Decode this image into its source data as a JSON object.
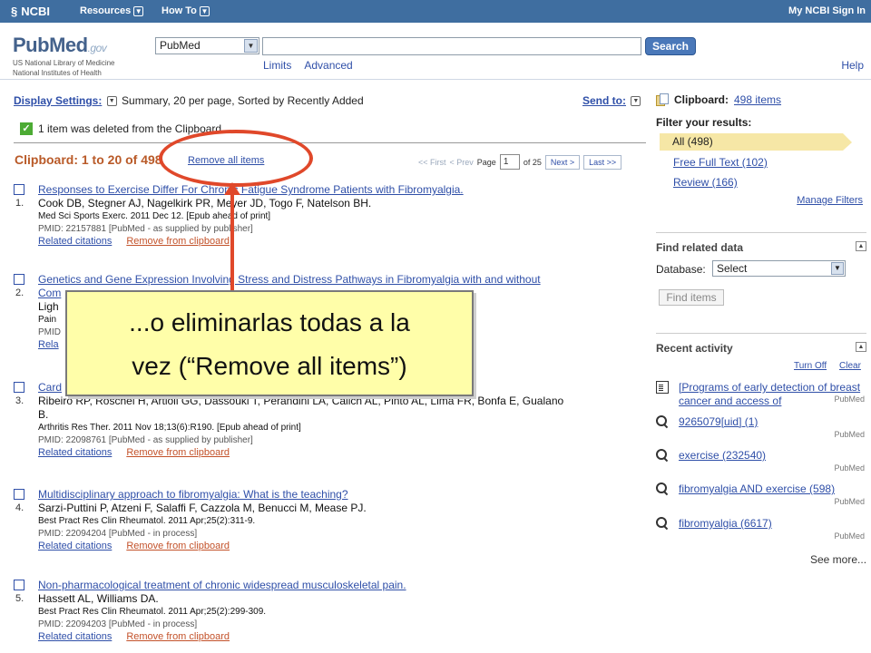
{
  "topbar": {
    "logo": "NCBI",
    "resources": "Resources",
    "howto": "How To",
    "right": "My NCBI  Sign In"
  },
  "header": {
    "brand_main": "Pub",
    "brand_m": "M",
    "brand_ed": "ed",
    "brand_gov": ".gov",
    "sub1": "US National Library of Medicine",
    "sub2": "National Institutes of Health",
    "db_selected": "PubMed",
    "search_value": "",
    "search_button": "Search",
    "limits": "Limits",
    "advanced": "Advanced",
    "help": "Help"
  },
  "display": {
    "label": "Display Settings:",
    "value": "Summary, 20 per page, Sorted by Recently Added",
    "send_to": "Send to:"
  },
  "notice": "1 item was deleted from the Clipboard",
  "clipboard": {
    "title": "Clipboard: 1 to 20 of 498",
    "remove_all": "Remove all items"
  },
  "pager": {
    "first": "<< First",
    "prev": "< Prev",
    "page_label": "Page",
    "page": "1",
    "of": "of 25",
    "next": "Next >",
    "last": "Last >>"
  },
  "results": [
    {
      "num": "1.",
      "title": "Responses to Exercise Differ For Chronic Fatigue Syndrome Patients with Fibromyalgia.",
      "authors": "Cook DB, Stegner AJ, Nagelkirk PR, Meyer JD, Togo F, Natelson BH.",
      "journal": "Med Sci Sports Exerc. 2011 Dec 12. [Epub ahead of print]",
      "pmid": "PMID: 22157881 [PubMed - as supplied by publisher]"
    },
    {
      "num": "2.",
      "title": "Genetics and Gene Expression Involving Stress and Distress Pathways in Fibromyalgia with and without",
      "title2": "Com",
      "authors": "Ligh",
      "journal": "Pain",
      "pmid": "PMID"
    },
    {
      "num": "3.",
      "title": "Card",
      "authors": "Ribeiro RP, Roschel H, Artioli GG, Dassouki T, Perandini LA, Calich AL, Pinto AL, Lima FR, Bonfa E, Gualano",
      "authors2": "B.",
      "journal": "Arthritis Res Ther. 2011 Nov 18;13(6):R190. [Epub ahead of print]",
      "pmid": "PMID: 22098761 [PubMed - as supplied by publisher]"
    },
    {
      "num": "4.",
      "title": "Multidisciplinary approach to fibromyalgia: What is the teaching?",
      "authors": "Sarzi-Puttini P, Atzeni F, Salaffi F, Cazzola M, Benucci M, Mease PJ.",
      "journal": "Best Pract Res Clin Rheumatol. 2011 Apr;25(2):311-9.",
      "pmid": "PMID: 22094204 [PubMed - in process]"
    },
    {
      "num": "5.",
      "title": "Non-pharmacological treatment of chronic widespread musculoskeletal pain.",
      "authors": "Hassett AL, Williams DA.",
      "journal": "Best Pract Res Clin Rheumatol. 2011 Apr;25(2):299-309.",
      "pmid": "PMID: 22094203 [PubMed - in process]"
    }
  ],
  "result_links": {
    "related": "Related citations",
    "remove": "Remove from clipboard",
    "rel_cut": "Rela"
  },
  "sidebar": {
    "clip_label": "Clipboard:",
    "clip_count": "498 items",
    "filter_header": "Filter your results:",
    "filter_all": "All (498)",
    "filter_free": "Free Full Text (102)",
    "filter_review": "Review (166)",
    "manage": "Manage Filters",
    "find_header": "Find related data",
    "db_label": "Database:",
    "db_select": "Select",
    "find_btn": "Find items",
    "recent_header": "Recent activity",
    "turn_off": "Turn Off",
    "clear": "Clear",
    "activity": [
      {
        "text": "[Programs of early detection of breast cancer and access of",
        "src": "PubMed",
        "icon": "document-icon"
      },
      {
        "text": "9265079[uid] (1)",
        "src": "PubMed",
        "icon": "search-icon"
      },
      {
        "text": "exercise (232540)",
        "src": "PubMed",
        "icon": "search-icon"
      },
      {
        "text": "fibromyalgia AND exercise (598)",
        "src": "PubMed",
        "icon": "search-icon"
      },
      {
        "text": "fibromyalgia (6617)",
        "src": "PubMed",
        "icon": "search-icon"
      }
    ],
    "see_more": "See more..."
  },
  "callout": {
    "line1": "...o eliminarlas todas a la",
    "line2": "vez (“Remove all items”)"
  },
  "colors": {
    "topbar": "#3f6ea0",
    "accent_orange": "#b95a28",
    "annotation_red": "#e0482a",
    "callout_bg": "#fffea9"
  }
}
